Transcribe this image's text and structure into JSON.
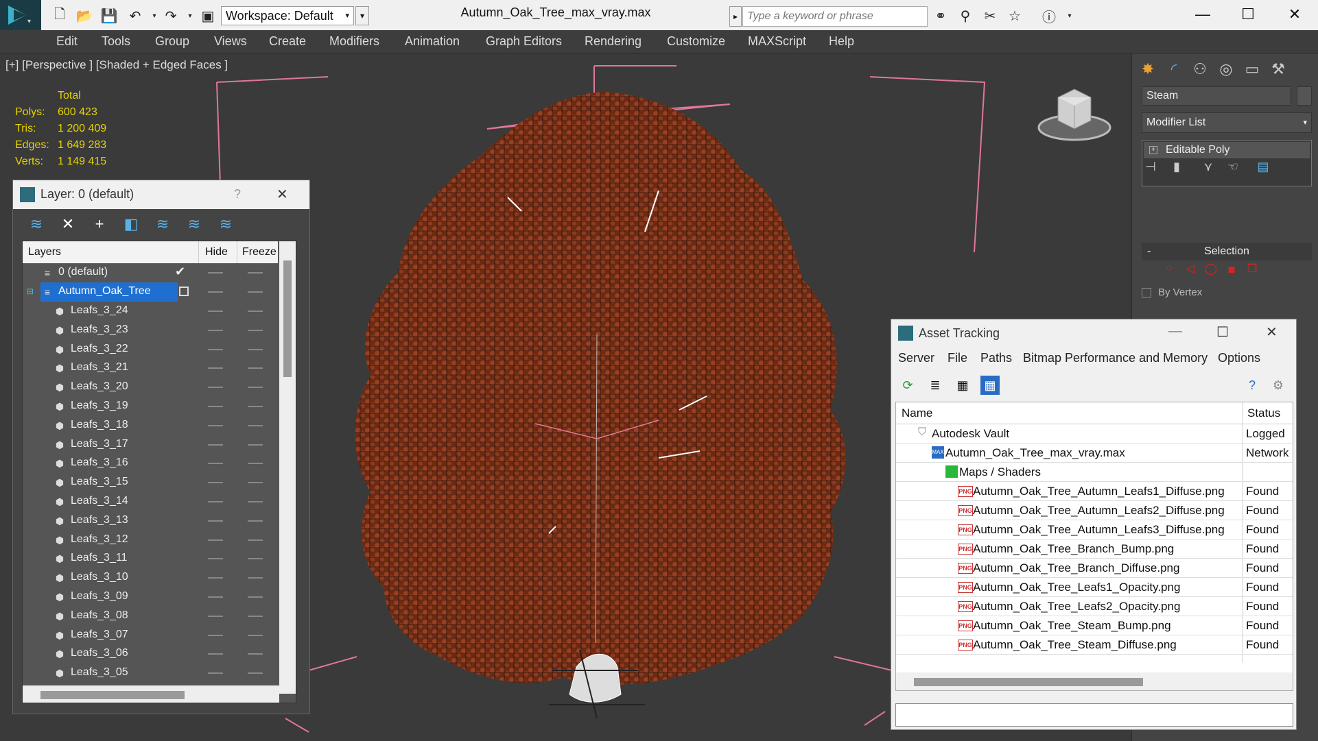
{
  "titlebar": {
    "workspace_label": "Workspace: Default",
    "document_title": "Autumn_Oak_Tree_max_vray.max",
    "search_placeholder": "Type a keyword or phrase"
  },
  "menu": [
    "Edit",
    "Tools",
    "Group",
    "Views",
    "Create",
    "Modifiers",
    "Animation",
    "Graph Editors",
    "Rendering",
    "Customize",
    "MAXScript",
    "Help"
  ],
  "viewport": {
    "label": "[+] [Perspective ] [Shaded + Edged Faces ]",
    "stats": {
      "header": "Total",
      "rows": [
        {
          "label": "Polys:",
          "value": "600 423"
        },
        {
          "label": "Tris:",
          "value": "1 200 409"
        },
        {
          "label": "Edges:",
          "value": "1 649 283"
        },
        {
          "label": "Verts:",
          "value": "1 149 415"
        }
      ]
    }
  },
  "layer_panel": {
    "title": "Layer: 0 (default)",
    "help": "?",
    "columns": {
      "layers": "Layers",
      "hide": "Hide",
      "freeze": "Freeze"
    },
    "default_layer": "0 (default)",
    "selected_layer": "Autumn_Oak_Tree",
    "objects": [
      "Leafs_3_24",
      "Leafs_3_23",
      "Leafs_3_22",
      "Leafs_3_21",
      "Leafs_3_20",
      "Leafs_3_19",
      "Leafs_3_18",
      "Leafs_3_17",
      "Leafs_3_16",
      "Leafs_3_15",
      "Leafs_3_14",
      "Leafs_3_13",
      "Leafs_3_12",
      "Leafs_3_11",
      "Leafs_3_10",
      "Leafs_3_09",
      "Leafs_3_08",
      "Leafs_3_07",
      "Leafs_3_06",
      "Leafs_3_05"
    ]
  },
  "command_panel": {
    "object_name": "Steam",
    "modifier_list": "Modifier List",
    "modifier_item": "Editable Poly",
    "selection_title": "Selection",
    "by_vertex": "By Vertex"
  },
  "asset_tracking": {
    "title": "Asset Tracking",
    "menu": [
      "Server",
      "File",
      "Paths",
      "Bitmap Performance and Memory",
      "Options"
    ],
    "columns": {
      "name": "Name",
      "status": "Status"
    },
    "vault": {
      "name": "Autodesk Vault",
      "status": "Logged"
    },
    "file": {
      "name": "Autumn_Oak_Tree_max_vray.max",
      "status": "Network"
    },
    "group": "Maps / Shaders",
    "maps": [
      {
        "name": "Autumn_Oak_Tree_Autumn_Leafs1_Diffuse.png",
        "status": "Found"
      },
      {
        "name": "Autumn_Oak_Tree_Autumn_Leafs2_Diffuse.png",
        "status": "Found"
      },
      {
        "name": "Autumn_Oak_Tree_Autumn_Leafs3_Diffuse.png",
        "status": "Found"
      },
      {
        "name": "Autumn_Oak_Tree_Branch_Bump.png",
        "status": "Found"
      },
      {
        "name": "Autumn_Oak_Tree_Branch_Diffuse.png",
        "status": "Found"
      },
      {
        "name": "Autumn_Oak_Tree_Leafs1_Opacity.png",
        "status": "Found"
      },
      {
        "name": "Autumn_Oak_Tree_Leafs2_Opacity.png",
        "status": "Found"
      },
      {
        "name": "Autumn_Oak_Tree_Steam_Bump.png",
        "status": "Found"
      },
      {
        "name": "Autumn_Oak_Tree_Steam_Diffuse.png",
        "status": "Found"
      }
    ],
    "png_badge": "PNG"
  },
  "colors": {
    "leaves": "#8a3a1e",
    "bbox": "#e07898",
    "stats": "#e6d200",
    "selection": "#1f6fd1"
  }
}
